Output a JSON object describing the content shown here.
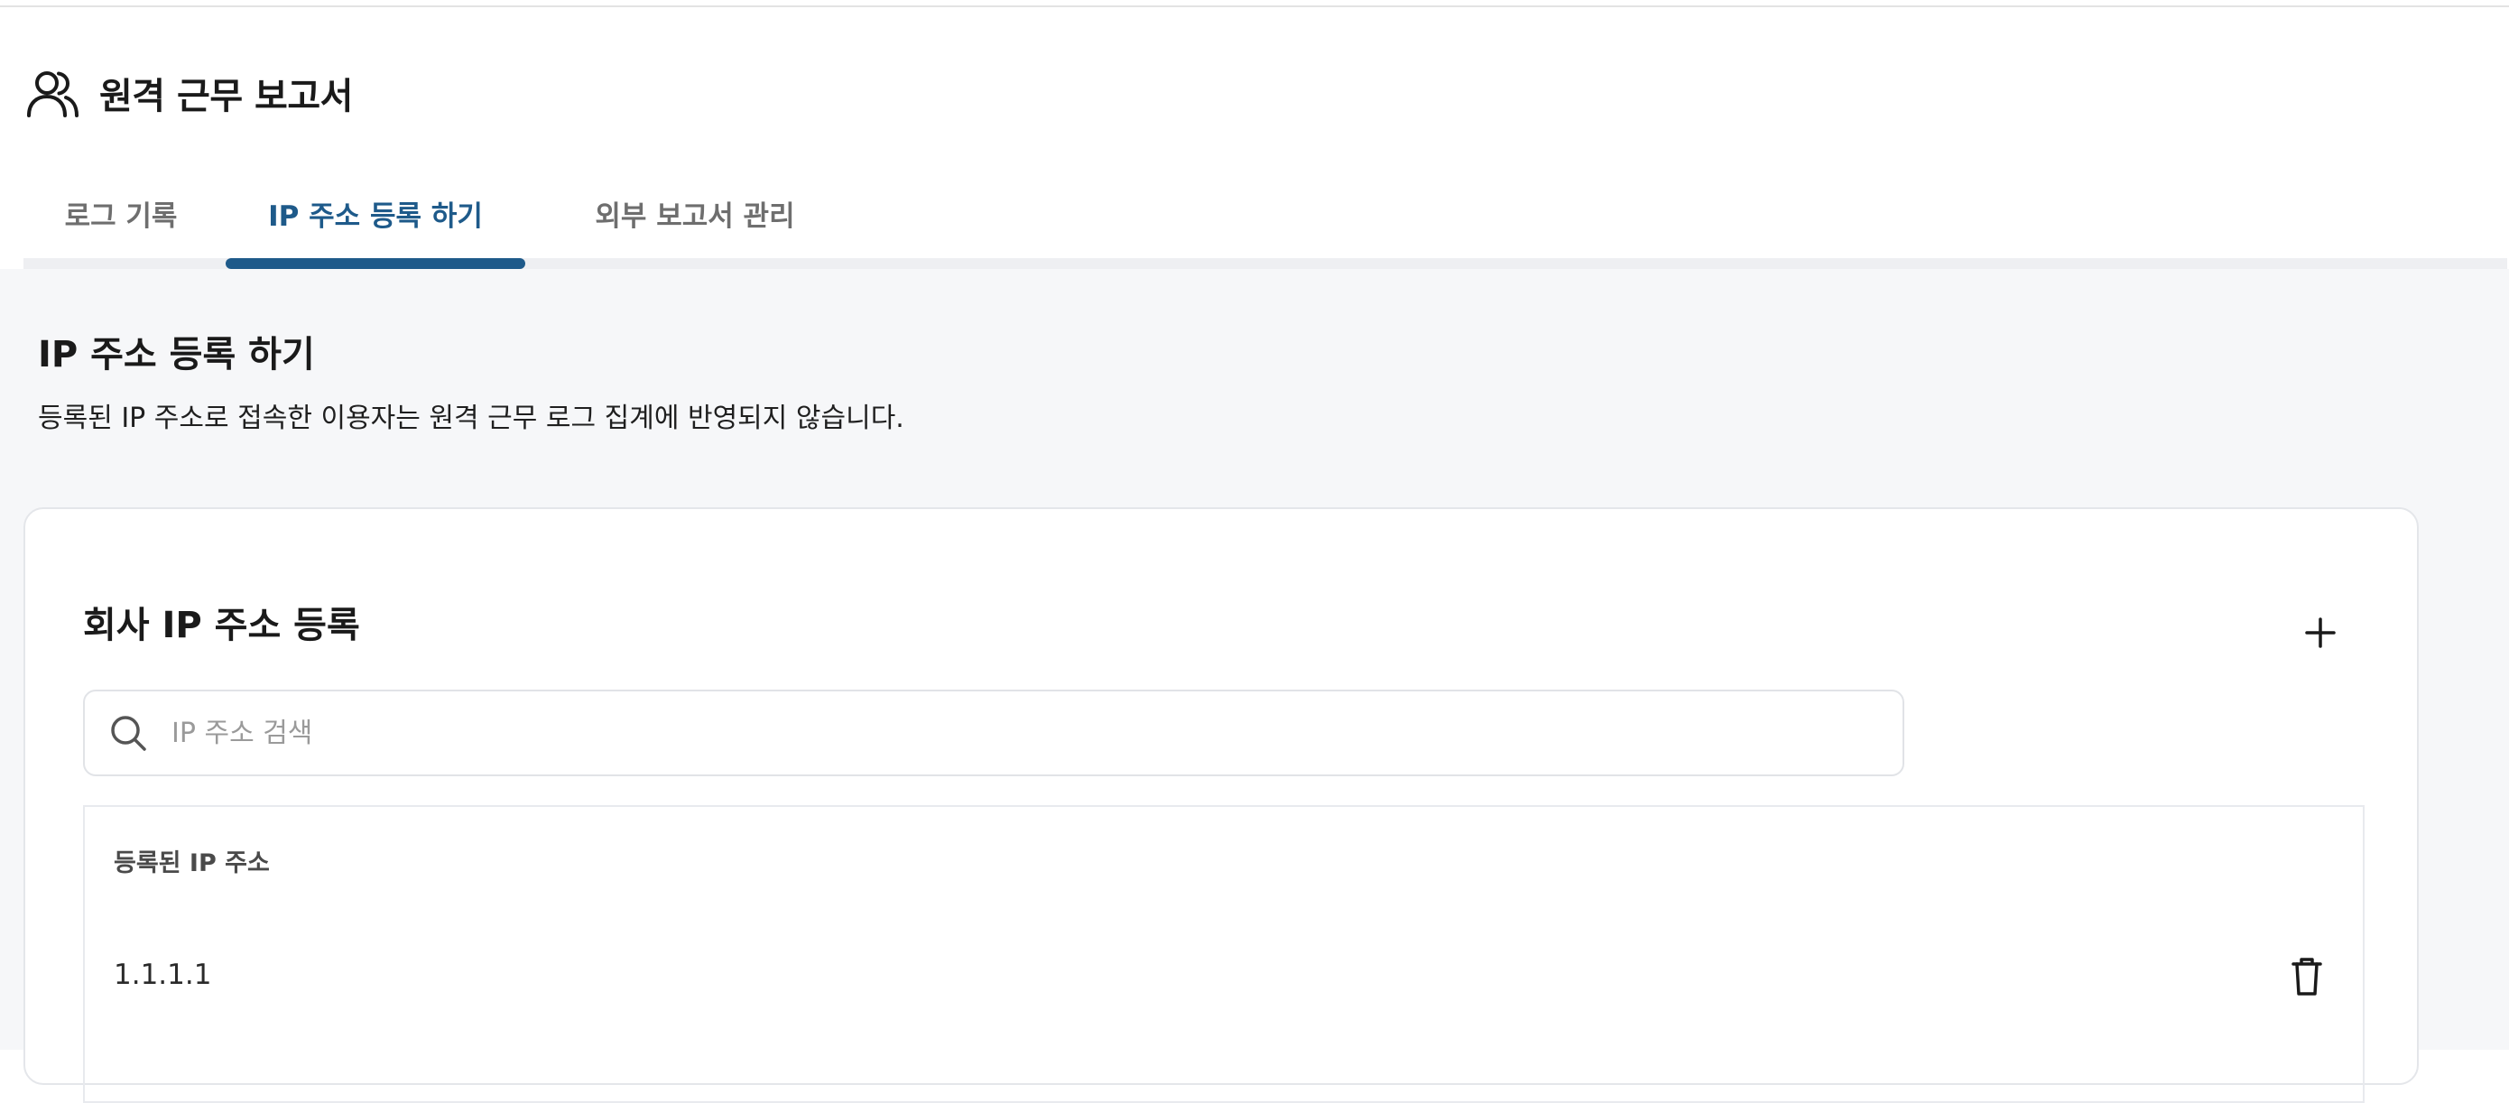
{
  "header": {
    "icon": "users-icon",
    "title": "원격 근무 보고서"
  },
  "tabs": [
    {
      "label": "로그 기록",
      "active": false
    },
    {
      "label": "IP 주소 등록 하기",
      "active": true
    },
    {
      "label": "외부 보고서 관리",
      "active": false
    }
  ],
  "section": {
    "title": "IP 주소 등록 하기",
    "description": "등록된 IP 주소로 접속한 이용자는 원격 근무 로그 집계에 반영되지 않습니다."
  },
  "card": {
    "title": "회사 IP 주소 등록",
    "add_icon": "plus-icon",
    "search": {
      "icon": "search-icon",
      "placeholder": "IP 주소 검색",
      "value": ""
    },
    "table": {
      "header": "등록된 IP 주소",
      "rows": [
        {
          "ip": "1.1.1.1",
          "action_icon": "trash-icon"
        }
      ]
    }
  },
  "colors": {
    "accent": "#1e5a8a",
    "background": "#f6f7f9",
    "tab_track": "#eeeff2"
  }
}
